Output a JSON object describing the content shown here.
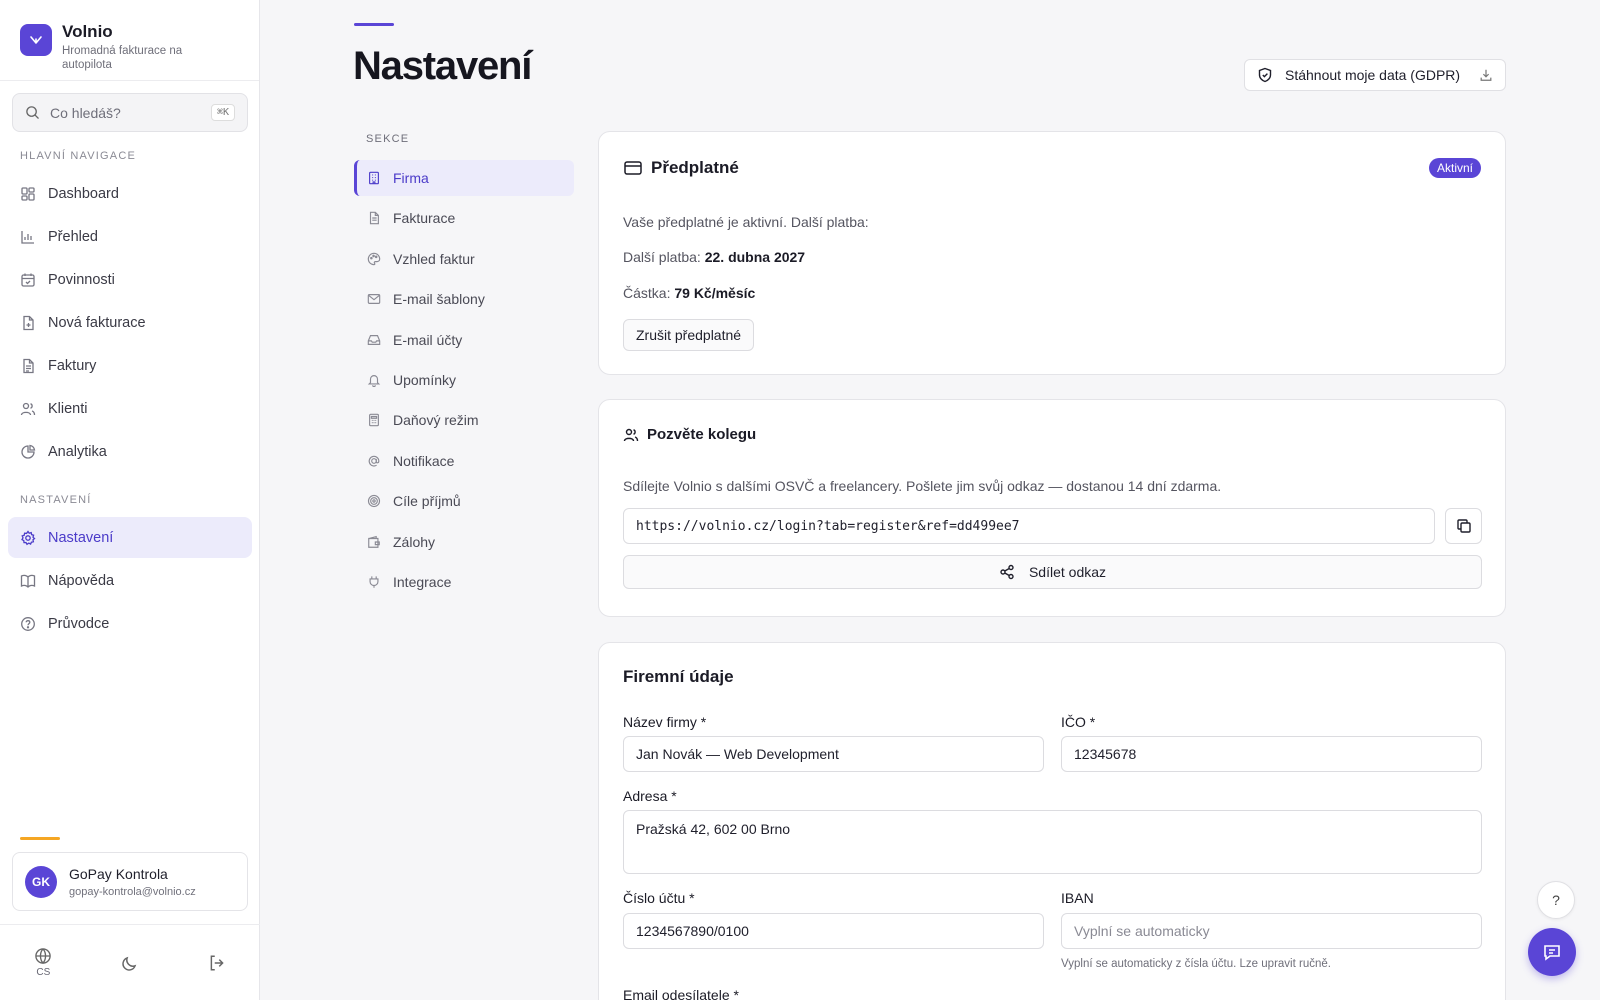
{
  "brand": {
    "name": "Volnio",
    "tagline": "Hromadná fakturace na autopilota"
  },
  "search": {
    "placeholder": "Co hledáš?",
    "shortcut": "⌘K"
  },
  "sidebar": {
    "main_section": "HLAVNÍ NAVIGACE",
    "main_items": [
      {
        "label": "Dashboard",
        "icon": "dashboard-icon"
      },
      {
        "label": "Přehled",
        "icon": "bar-chart-icon"
      },
      {
        "label": "Povinnosti",
        "icon": "calendar-icon"
      },
      {
        "label": "Nová fakturace",
        "icon": "file-plus-icon"
      },
      {
        "label": "Faktury",
        "icon": "file-text-icon"
      },
      {
        "label": "Klienti",
        "icon": "users-icon"
      },
      {
        "label": "Analytika",
        "icon": "pie-chart-icon"
      }
    ],
    "settings_section": "NASTAVENÍ",
    "settings_items": [
      {
        "label": "Nastavení",
        "icon": "gear-icon",
        "active": true
      },
      {
        "label": "Nápověda",
        "icon": "book-icon"
      },
      {
        "label": "Průvodce",
        "icon": "help-circle-icon"
      }
    ]
  },
  "user": {
    "initials": "GK",
    "name": "GoPay Kontrola",
    "email": "gopay-kontrola@volnio.cz"
  },
  "bottom": {
    "language": "CS"
  },
  "page": {
    "title": "Nastavení",
    "gdpr_button": "Stáhnout moje data (GDPR)"
  },
  "sections": {
    "label": "SEKCE",
    "items": [
      {
        "label": "Firma",
        "icon": "building-icon",
        "active": true
      },
      {
        "label": "Fakturace",
        "icon": "file-icon"
      },
      {
        "label": "Vzhled faktur",
        "icon": "palette-icon"
      },
      {
        "label": "E-mail šablony",
        "icon": "mail-icon"
      },
      {
        "label": "E-mail účty",
        "icon": "inbox-icon"
      },
      {
        "label": "Upomínky",
        "icon": "bell-icon"
      },
      {
        "label": "Daňový režim",
        "icon": "calculator-icon"
      },
      {
        "label": "Notifikace",
        "icon": "at-sign-icon"
      },
      {
        "label": "Cíle příjmů",
        "icon": "target-icon"
      },
      {
        "label": "Zálohy",
        "icon": "wallet-icon"
      },
      {
        "label": "Integrace",
        "icon": "plug-icon"
      }
    ]
  },
  "subscription": {
    "title": "Předplatné",
    "badge": "Aktivní",
    "status_text": "Vaše předplatné je aktivní. Další platba:",
    "next_payment_label": "Další platba:",
    "next_payment_value": "22. dubna 2027",
    "amount_label": "Částka:",
    "amount_value": "79 Kč/měsíc",
    "cancel_button": "Zrušit předplatné"
  },
  "invite": {
    "title": "Pozvěte kolegu",
    "description": "Sdílejte Volnio s dalšími OSVČ a freelancery. Pošlete jim svůj odkaz — dostanou 14 dní zdarma.",
    "link": "https://volnio.cz/login?tab=register&ref=dd499ee7",
    "share_button": "Sdílet odkaz"
  },
  "company": {
    "title": "Firemní údaje",
    "name_label": "Název firmy *",
    "name_value": "Jan Novák — Web Development",
    "ico_label": "IČO *",
    "ico_value": "12345678",
    "address_label": "Adresa *",
    "address_value": "Pražská 42, 602 00 Brno",
    "account_label": "Číslo účtu *",
    "account_value": "1234567890/0100",
    "iban_label": "IBAN",
    "iban_placeholder": "Vyplní se automaticky",
    "iban_hint": "Vyplní se automaticky z čísla účtu. Lze upravit ručně.",
    "email_label": "Email odesílatele *"
  },
  "fab": {
    "help": "?"
  },
  "colors": {
    "accent": "#5a45d6",
    "active_bg": "#ecebfb",
    "warning": "#f5a623"
  }
}
